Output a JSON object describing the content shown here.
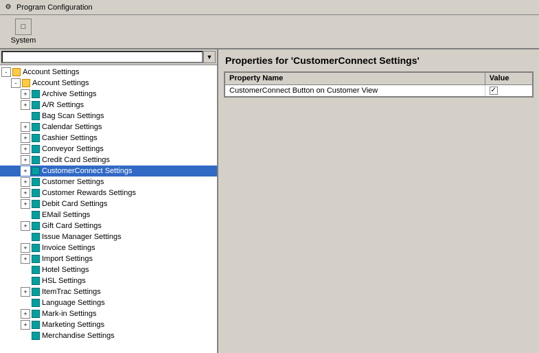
{
  "titleBar": {
    "icon": "⚙",
    "title": "Program Configuration"
  },
  "toolbar": {
    "systemButton": {
      "label": "System",
      "icon": "□"
    }
  },
  "leftPanel": {
    "searchPlaceholder": "",
    "searchValue": "",
    "dropdownArrow": "▼"
  },
  "tree": {
    "rootLabel": "Account Settings",
    "items": [
      {
        "label": "Account Settings",
        "level": 1,
        "expanded": true,
        "hasExpander": true,
        "expandedState": "-"
      },
      {
        "label": "Archive Settings",
        "level": 2,
        "hasExpander": true,
        "expandedState": "+"
      },
      {
        "label": "A/R Settings",
        "level": 2,
        "hasExpander": true,
        "expandedState": "+"
      },
      {
        "label": "Bag Scan Settings",
        "level": 2,
        "hasExpander": false
      },
      {
        "label": "Calendar Settings",
        "level": 2,
        "hasExpander": true,
        "expandedState": "+"
      },
      {
        "label": "Cashier Settings",
        "level": 2,
        "hasExpander": true,
        "expandedState": "+"
      },
      {
        "label": "Conveyor Settings",
        "level": 2,
        "hasExpander": true,
        "expandedState": "+"
      },
      {
        "label": "Credit Card Settings",
        "level": 2,
        "hasExpander": true,
        "expandedState": "+"
      },
      {
        "label": "CustomerConnect Settings",
        "level": 2,
        "hasExpander": true,
        "expandedState": "+",
        "selected": true
      },
      {
        "label": "Customer Settings",
        "level": 2,
        "hasExpander": true,
        "expandedState": "+"
      },
      {
        "label": "Customer Rewards Settings",
        "level": 2,
        "hasExpander": true,
        "expandedState": "+"
      },
      {
        "label": "Debit Card Settings",
        "level": 2,
        "hasExpander": true,
        "expandedState": "+"
      },
      {
        "label": "EMail Settings",
        "level": 2,
        "hasExpander": false
      },
      {
        "label": "Gift Card Settings",
        "level": 2,
        "hasExpander": true,
        "expandedState": "+"
      },
      {
        "label": "Issue Manager Settings",
        "level": 2,
        "hasExpander": false
      },
      {
        "label": "Invoice Settings",
        "level": 2,
        "hasExpander": true,
        "expandedState": "+"
      },
      {
        "label": "Import Settings",
        "level": 2,
        "hasExpander": true,
        "expandedState": "+"
      },
      {
        "label": "Hotel Settings",
        "level": 2,
        "hasExpander": false
      },
      {
        "label": "HSL Settings",
        "level": 2,
        "hasExpander": false
      },
      {
        "label": "ItemTrac Settings",
        "level": 2,
        "hasExpander": true,
        "expandedState": "+"
      },
      {
        "label": "Language Settings",
        "level": 2,
        "hasExpander": false
      },
      {
        "label": "Mark-in Settings",
        "level": 2,
        "hasExpander": true,
        "expandedState": "+"
      },
      {
        "label": "Marketing Settings",
        "level": 2,
        "hasExpander": true,
        "expandedState": "+"
      },
      {
        "label": "Merchandise Settings",
        "level": 2,
        "hasExpander": false
      }
    ]
  },
  "rightPanel": {
    "title": "Properties for 'CustomerConnect Settings'",
    "tableHeaders": {
      "propertyName": "Property Name",
      "value": "Value"
    },
    "rows": [
      {
        "propertyName": "CustomerConnect Button on Customer View",
        "value": "✓",
        "isCheckbox": true
      }
    ]
  }
}
